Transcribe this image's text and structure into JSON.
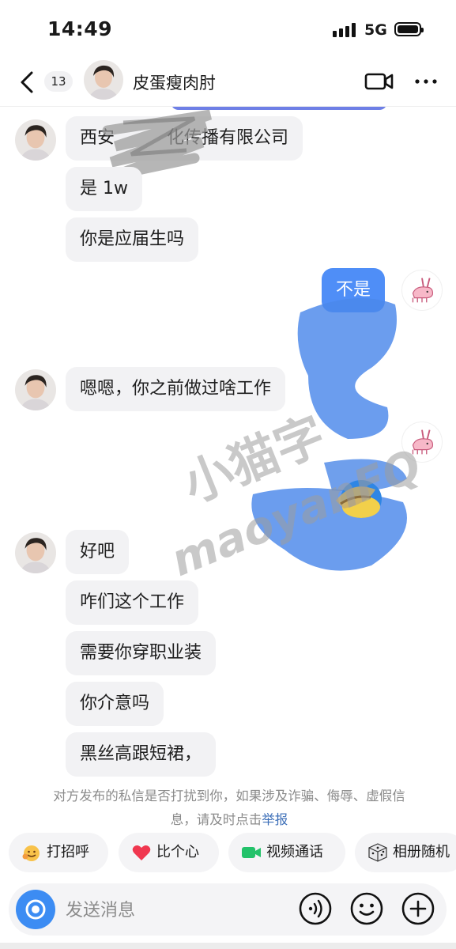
{
  "status_bar": {
    "time": "14:49",
    "network": "5G"
  },
  "header": {
    "unread_count": "13",
    "contact_name": "皮蛋瘦肉肘"
  },
  "messages": [
    {
      "side": "left",
      "text": "西安　　　化传播有限公司"
    },
    {
      "side": "left",
      "text": "是 1w"
    },
    {
      "side": "left",
      "text": "你是应届生吗"
    },
    {
      "side": "right",
      "text": "不是"
    },
    {
      "side": "left",
      "text": "嗯嗯，你之前做过啥工作"
    },
    {
      "side": "left",
      "text": "好吧"
    },
    {
      "side": "left",
      "text": "咋们这个工作"
    },
    {
      "side": "left",
      "text": "需要你穿职业装"
    },
    {
      "side": "left",
      "text": "你介意吗"
    },
    {
      "side": "left",
      "text": "黑丝高跟短裙，"
    }
  ],
  "notice": {
    "text": "对方发布的私信是否打扰到你，如果涉及诈骗、侮辱、虚假信息，请及时点击",
    "link": "举报"
  },
  "watermark": {
    "line1": "小猫字",
    "line2": "maoyanFQ"
  },
  "quick_actions": [
    {
      "label": "打招呼",
      "icon": "smile-wave-icon"
    },
    {
      "label": "比个心",
      "icon": "heart-icon"
    },
    {
      "label": "视频通话",
      "icon": "video-call-icon"
    },
    {
      "label": "相册随机",
      "icon": "dice-icon"
    }
  ],
  "input": {
    "placeholder": "发送消息"
  },
  "colors": {
    "my_bubble": "#4f8ef7",
    "their_bubble": "#f2f2f4",
    "accent": "#3c8cf3"
  }
}
